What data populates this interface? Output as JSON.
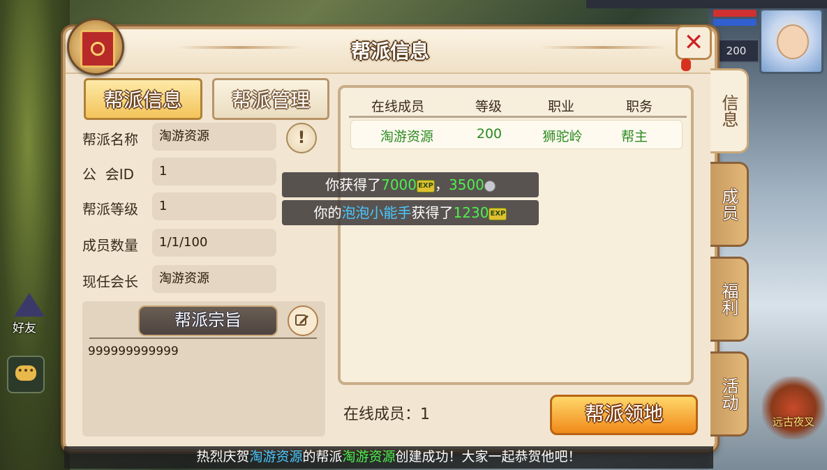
{
  "window": {
    "title": "帮派信息"
  },
  "player": {
    "level": "200"
  },
  "side": {
    "friend_label": "好友",
    "event_label": "远古夜叉"
  },
  "tabs": {
    "info": "帮派信息",
    "manage": "帮派管理"
  },
  "fields": [
    {
      "label": "帮派名称",
      "value": "淘游资源"
    },
    {
      "label": "公  会ID",
      "value": "1"
    },
    {
      "label": "帮派等级",
      "value": "1"
    },
    {
      "label": "成员数量",
      "value": "1/1/100"
    },
    {
      "label": "现任会长",
      "value": "淘游资源"
    }
  ],
  "warn_icon": "!",
  "motto": {
    "title": "帮派宗旨",
    "text": "999999999999"
  },
  "members": {
    "headers": [
      "在线成员",
      "等级",
      "职业",
      "职务"
    ],
    "rows": [
      {
        "name": "淘游资源",
        "level": "200",
        "class": "狮驼岭",
        "role": "帮主"
      }
    ],
    "online_label": "在线成员：1"
  },
  "territory_button": "帮派领地",
  "side_tabs": [
    "信息",
    "成员",
    "福利",
    "活动"
  ],
  "toasts": {
    "exp_prefix": "你获得了",
    "exp_value": "7000",
    "exp_sep": "，",
    "silver_value": "3500",
    "pet_prefix": "你的",
    "pet_name": "泡泡小能手",
    "pet_mid": "获得了",
    "pet_exp": "1230",
    "exp_badge": "EXP"
  },
  "announcement": {
    "p1": "热烈庆贺",
    "name1": "淘游资源",
    "p2": "的帮派",
    "name2": "淘游资源",
    "p3": "创建成功！大家一起恭贺他吧！"
  },
  "colors": {
    "accent_gold": "#f3c45a",
    "green_text": "#2a8a20",
    "close_red": "#d02020"
  }
}
